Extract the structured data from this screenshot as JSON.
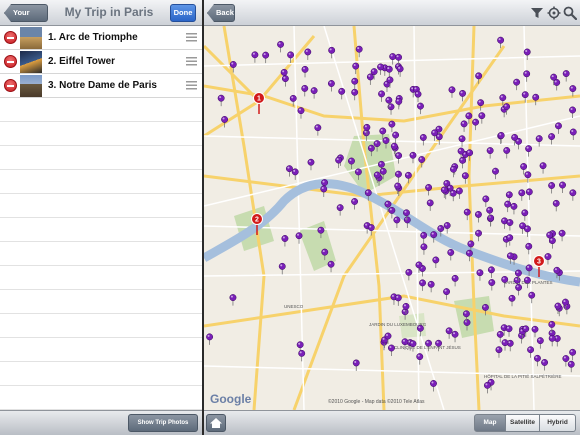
{
  "left_panel": {
    "nav": {
      "back_label": "Your Trips",
      "title": "My Trip in Paris",
      "done_label": "Done"
    },
    "items": [
      {
        "label": "1. Arc de Triomphe"
      },
      {
        "label": "2. Eiffel Tower"
      },
      {
        "label": "3. Notre Dame de Paris"
      }
    ],
    "toolbar": {
      "photos_label": "Show Trip Photos"
    }
  },
  "right_panel": {
    "nav": {
      "back_label": "Back",
      "icons": [
        "filter-icon",
        "locate-icon",
        "search-icon"
      ]
    },
    "map": {
      "google_label": "Google",
      "copyright": "©2010 Google - Map data ©2010 Tele Atlas",
      "numbered_pins": [
        "1",
        "2",
        "3"
      ],
      "labels": [
        {
          "text": "UNESCO"
        },
        {
          "text": "JARDIN DU LUXEMBOURG"
        },
        {
          "text": "JARDIN DES PLANTES"
        },
        {
          "text": "CLINIQUE DE L'ENFANT JÉSUS"
        },
        {
          "text": "HÔPITAL DE LA PITIÉ SALPÉTRIÈRE"
        }
      ]
    },
    "toolbar": {
      "segments": [
        "Map",
        "Satellite",
        "Hybrid"
      ],
      "selected": "Map"
    }
  },
  "colors": {
    "pin_purple": "#7a1fb8",
    "pin_red": "#d21b1b",
    "river": "#a5bfdd",
    "park": "#c7dcb0",
    "map_bg": "#f1ede4",
    "road": "#f7d26b"
  }
}
